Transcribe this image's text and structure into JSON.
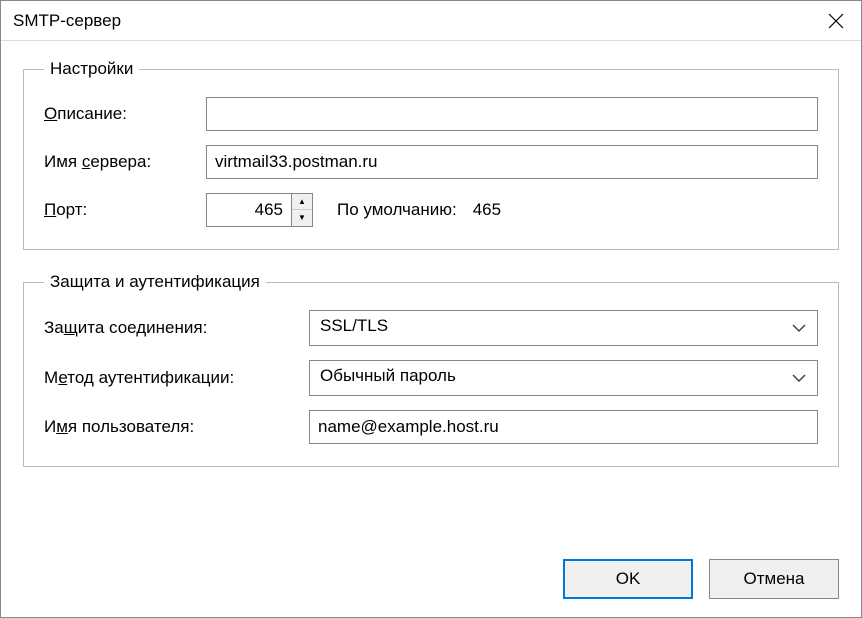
{
  "window": {
    "title": "SMTP-сервер"
  },
  "settings_group": {
    "legend": "Настройки",
    "description": {
      "label_pre": "О",
      "label_post": "писание:",
      "value": ""
    },
    "server_name": {
      "label_pre": "Имя ",
      "label_underline": "с",
      "label_post": "ервера:",
      "value": "virtmail33.postman.ru"
    },
    "port": {
      "label_underline": "П",
      "label_post": "орт:",
      "value": "465",
      "default_label": "По умолчанию:",
      "default_value": "465"
    }
  },
  "auth_group": {
    "legend": "Защита и аутентификация",
    "security": {
      "label_pre": "За",
      "label_underline": "щ",
      "label_post": "ита соединения:",
      "value": "SSL/TLS"
    },
    "method": {
      "label_pre": "М",
      "label_underline": "е",
      "label_post": "тод аутентификации:",
      "value": "Обычный пароль"
    },
    "username": {
      "label_pre": "И",
      "label_underline": "м",
      "label_post": "я пользователя:",
      "value": "name@example.host.ru"
    }
  },
  "buttons": {
    "ok": "OK",
    "cancel": "Отмена"
  }
}
